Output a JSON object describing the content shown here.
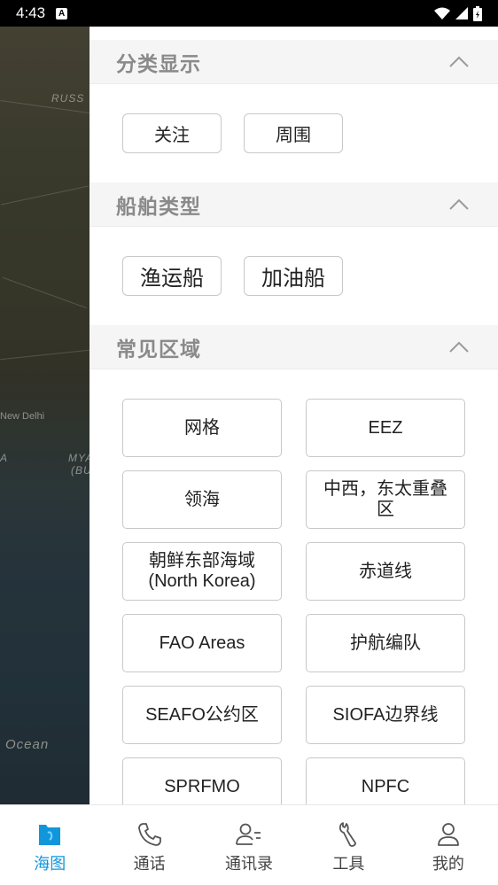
{
  "status_bar": {
    "time": "4:43",
    "notification_icon": "a-icon",
    "right_icons": [
      "wifi-icon",
      "signal-icon",
      "battery-icon"
    ]
  },
  "map": {
    "labels": {
      "country1": "RUSS",
      "city": "New Delhi",
      "country2": "MYA",
      "country2_sub": "(BU",
      "region_left": "A",
      "ocean": "Ocean"
    }
  },
  "sections": {
    "classification": {
      "title": "分类显示",
      "chips": [
        "关注",
        "周围"
      ]
    },
    "ship_type": {
      "title": "船舶类型",
      "chips": [
        "渔运船",
        "加油船"
      ]
    },
    "common_area": {
      "title": "常见区域",
      "buttons": [
        "网格",
        "EEZ",
        "领海",
        "中西，东太重叠区",
        "朝鲜东部海域(North Korea)",
        "赤道线",
        "FAO Areas",
        "护航编队",
        "SEAFO公约区",
        "SIOFA边界线",
        "SPRFMO",
        "NPFC"
      ]
    }
  },
  "bottom_nav": {
    "items": [
      {
        "label": "海图",
        "icon": "sea-chart-icon",
        "active": true
      },
      {
        "label": "通话",
        "icon": "phone-icon",
        "active": false
      },
      {
        "label": "通讯录",
        "icon": "contacts-icon",
        "active": false
      },
      {
        "label": "工具",
        "icon": "wrench-icon",
        "active": false
      },
      {
        "label": "我的",
        "icon": "user-icon",
        "active": false
      }
    ]
  },
  "colors": {
    "accent": "#1296db",
    "header_bg": "#f5f5f5",
    "header_text": "#8a8a8a"
  }
}
